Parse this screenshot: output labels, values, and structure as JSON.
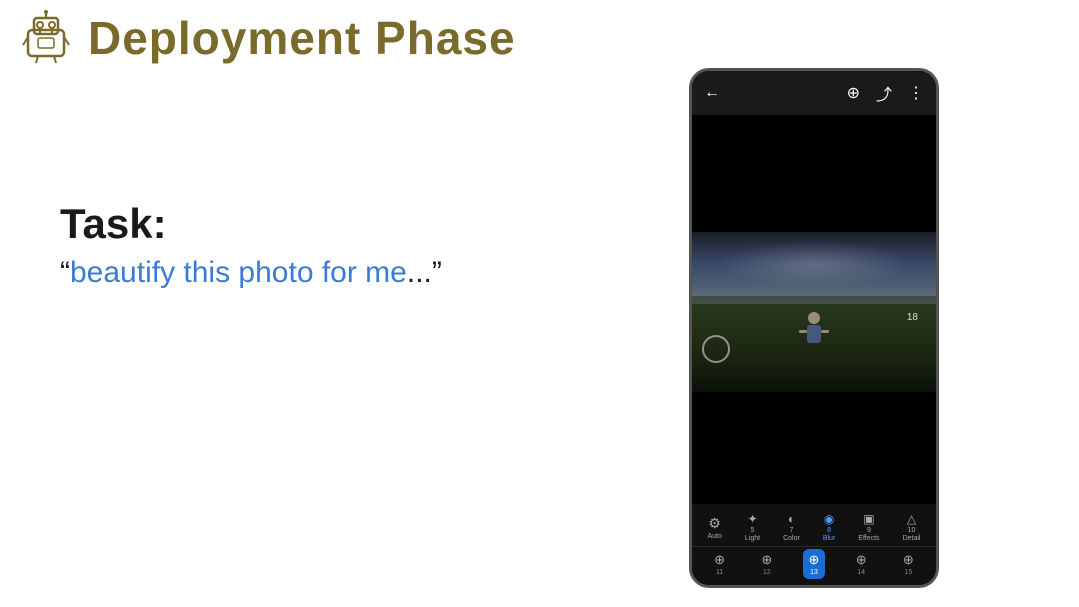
{
  "header": {
    "title": "Deployment Phase",
    "icon_alt": "robot-icon"
  },
  "task": {
    "label": "Task:",
    "quote_open": "“",
    "quote_text": "beautify this photo for me",
    "quote_ellipsis": "...",
    "quote_close": "”"
  },
  "phone": {
    "topbar": {
      "back_icon": "←",
      "search_icon": "⊕",
      "share_icon": "⤴",
      "more_icon": "⋮"
    },
    "photo": {
      "number": "18"
    },
    "toolbar_main": [
      {
        "label": "Auto",
        "num": ""
      },
      {
        "label": "Light",
        "num": "5"
      },
      {
        "label": "Color",
        "num": "7"
      },
      {
        "label": "Blur",
        "num": "8"
      },
      {
        "label": "Effects",
        "num": "9"
      },
      {
        "label": "Detail",
        "num": "10"
      }
    ],
    "toolbar_sub": [
      {
        "label": "11",
        "active": false
      },
      {
        "label": "12",
        "active": false
      },
      {
        "label": "13",
        "active": true
      },
      {
        "label": "14",
        "active": false
      },
      {
        "label": "15",
        "active": false
      }
    ]
  },
  "colors": {
    "title": "#7B6B2A",
    "quote_text": "#3a7bd5",
    "quote_marks": "#1a1a1a",
    "task_label": "#1a1a1a",
    "active_tab": "#1a6dd4"
  }
}
